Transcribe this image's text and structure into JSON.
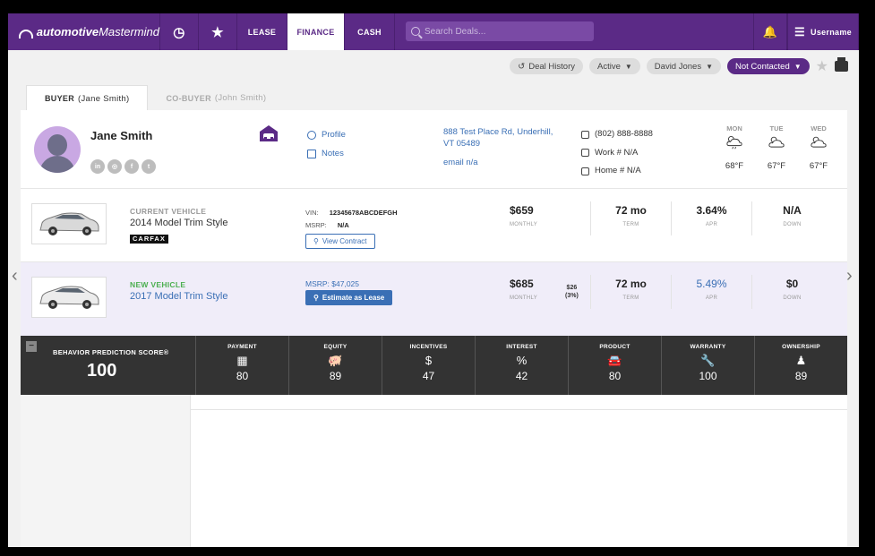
{
  "nav": {
    "logo_bold": "automotive",
    "logo_rest": "Mastermind",
    "tabs": [
      "LEASE",
      "FINANCE",
      "CASH"
    ],
    "search_placeholder": "Search Deals...",
    "username": "Username"
  },
  "actions": {
    "deal_history": "Deal History",
    "status_filter": "Active",
    "salesperson": "David Jones",
    "contact_status": "Not Contacted"
  },
  "tabs": {
    "buyer": "BUYER",
    "buyer_name": "(Jane Smith)",
    "cobuyer": "CO-BUYER",
    "cobuyer_name": "(John Smith)"
  },
  "buyer": {
    "name": "Jane Smith",
    "socials": [
      "in",
      "◎",
      "f",
      "t"
    ],
    "links": {
      "profile": "Profile",
      "notes": "Notes"
    },
    "address_line1": "888 Test Place Rd, Underhill,",
    "address_line2": "VT 05489",
    "email": "email n/a",
    "phone": "(802) 888-8888",
    "work": "Work # N/A",
    "home": "Home # N/A"
  },
  "weather": [
    {
      "day": "MON",
      "temp": "68°F",
      "icon": "rain-cloud-icon"
    },
    {
      "day": "TUE",
      "temp": "67°F",
      "icon": "partly-cloudy-icon"
    },
    {
      "day": "WED",
      "temp": "67°F",
      "icon": "partly-cloudy-icon"
    }
  ],
  "current_vehicle": {
    "label": "CURRENT VEHICLE",
    "model": "2014 Model Trim Style",
    "carfax": "CARFAX",
    "vin_label": "VIN:",
    "vin": "12345678ABCDEFGH",
    "msrp_label": "MSRP:",
    "msrp": "N/A",
    "view_contract": "View Contract",
    "monthly": "$659",
    "term": "72 mo",
    "apr": "3.64%",
    "down": "N/A"
  },
  "new_vehicle": {
    "label": "NEW VEHICLE",
    "model": "2017 Model Trim Style",
    "msrp": "MSRP: $47,025",
    "estimate_lease": "Estimate as Lease",
    "monthly": "$685",
    "diff": "$26",
    "diff_pct": "(3%)",
    "term": "72 mo",
    "apr": "5.49%",
    "down": "$0"
  },
  "metric_labels": {
    "monthly": "MONTHLY",
    "term": "TERM",
    "apr": "APR",
    "down": "DOWN"
  },
  "behavior": {
    "label": "BEHAVIOR PREDICTION SCORE®",
    "score": "100",
    "cells": [
      {
        "label": "PAYMENT",
        "icon": "calculator-icon",
        "glyph": "▦",
        "value": "80"
      },
      {
        "label": "EQUITY",
        "icon": "piggy-bank-icon",
        "glyph": "🐖",
        "value": "89"
      },
      {
        "label": "INCENTIVES",
        "icon": "money-bag-icon",
        "glyph": "$",
        "value": "47"
      },
      {
        "label": "INTEREST",
        "icon": "percent-icon",
        "glyph": "%",
        "value": "42"
      },
      {
        "label": "PRODUCT",
        "icon": "car-icon",
        "glyph": "🚘",
        "value": "80"
      },
      {
        "label": "WARRANTY",
        "icon": "wrench-icon",
        "glyph": "🔧",
        "value": "100"
      },
      {
        "label": "OWNERSHIP",
        "icon": "person-key-icon",
        "glyph": "♟",
        "value": "89"
      }
    ]
  },
  "colors": {
    "brand": "#5b2a86",
    "link": "#3a6fb5",
    "strip": "#333333"
  }
}
